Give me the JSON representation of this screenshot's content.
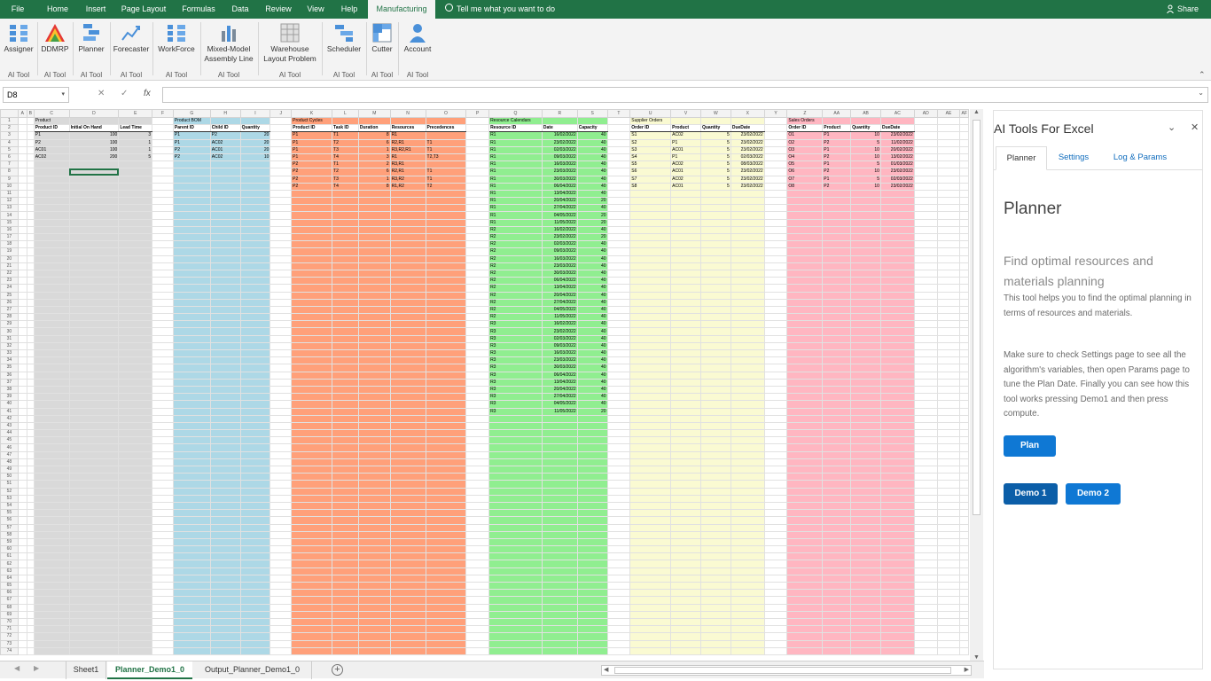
{
  "menu": {
    "items": [
      "File",
      "Home",
      "Insert",
      "Page Layout",
      "Formulas",
      "Data",
      "Review",
      "View",
      "Help",
      "Manufacturing"
    ],
    "active": "Manufacturing",
    "tell_me": "Tell me what you want to do",
    "share": "Share"
  },
  "ribbon": {
    "buttons": [
      {
        "label": "Assigner",
        "group": "AI Tool",
        "icon": "assigner-icon"
      },
      {
        "label": "DDMRP",
        "group": "AI Tool",
        "icon": "ddmrp-icon"
      },
      {
        "label": "Planner",
        "group": "AI Tool",
        "icon": "planner-icon"
      },
      {
        "label": "Forecaster",
        "group": "AI Tool",
        "icon": "forecaster-icon"
      },
      {
        "label": "WorkForce",
        "group": "AI Tool",
        "icon": "workforce-icon"
      },
      {
        "label": "Mixed-Model Assembly Line",
        "group": "AI Tool",
        "icon": "assembly-line-icon"
      },
      {
        "label": "Warehouse Layout Problem",
        "group": "AI Tool",
        "icon": "warehouse-icon"
      },
      {
        "label": "Scheduler",
        "group": "AI Tool",
        "icon": "scheduler-icon"
      },
      {
        "label": "Cutter",
        "group": "AI Tool",
        "icon": "cutter-icon"
      },
      {
        "label": "Account",
        "group": "AI Tool",
        "icon": "account-icon"
      }
    ]
  },
  "formula_bar": {
    "name_box": "D8",
    "fx": "fx",
    "cancel": "✕",
    "enter": "✓",
    "value": ""
  },
  "sheet": {
    "columns": [
      "A",
      "B",
      "C",
      "D",
      "E",
      "F",
      "G",
      "H",
      "I",
      "J",
      "K",
      "L",
      "M",
      "N",
      "O",
      "P",
      "Q",
      "R",
      "S",
      "T",
      "U",
      "V",
      "W",
      "X",
      "Y",
      "Z",
      "AA",
      "AB",
      "AC",
      "AD",
      "AE",
      "AF"
    ],
    "row_count": 74,
    "sections": [
      {
        "title": "Product",
        "headers": [
          "Product ID",
          "Initial On Hand",
          "Lead Time"
        ],
        "color": "#d9d9d9",
        "rows": [
          [
            "P1",
            "100",
            "3"
          ],
          [
            "P2",
            "100",
            "1"
          ],
          [
            "AC01",
            "100",
            "1"
          ],
          [
            "AC02",
            "200",
            "5"
          ]
        ]
      },
      {
        "title": "Product BOM",
        "headers": [
          "Parent ID",
          "Child ID",
          "Quantity"
        ],
        "color": "#add8e6",
        "rows": [
          [
            "P1",
            "P2",
            "20"
          ],
          [
            "P1",
            "AC02",
            "20"
          ],
          [
            "P2",
            "AC01",
            "20"
          ],
          [
            "P2",
            "AC02",
            "10"
          ]
        ]
      },
      {
        "title": "Product Cycles",
        "headers": [
          "Product ID",
          "Task ID",
          "Duration",
          "Resources",
          "Precedences"
        ],
        "color": "#ffa07a",
        "rows": [
          [
            "P1",
            "T1",
            "8",
            "R1",
            ""
          ],
          [
            "P1",
            "T2",
            "6",
            "R2,R1",
            "T1"
          ],
          [
            "P1",
            "T3",
            "1",
            "R3,R2,R1",
            "T1"
          ],
          [
            "P1",
            "T4",
            "3",
            "R1",
            "T2,T3"
          ],
          [
            "P2",
            "T1",
            "2",
            "R3,R1",
            ""
          ],
          [
            "P2",
            "T2",
            "6",
            "R2,R1",
            "T1"
          ],
          [
            "P2",
            "T3",
            "1",
            "R3,R2",
            "T1"
          ],
          [
            "P2",
            "T4",
            "8",
            "R1,R2",
            "T2"
          ]
        ]
      },
      {
        "title": "Resource Calendars",
        "headers": [
          "Resource ID",
          "Date",
          "Capacity"
        ],
        "color": "#90ee90",
        "rows": [
          [
            "R1",
            "16/02/2022",
            "40"
          ],
          [
            "R1",
            "23/02/2022",
            "40"
          ],
          [
            "R1",
            "02/03/2022",
            "40"
          ],
          [
            "R1",
            "09/03/2022",
            "40"
          ],
          [
            "R1",
            "16/03/2022",
            "40"
          ],
          [
            "R1",
            "23/03/2022",
            "40"
          ],
          [
            "R1",
            "30/03/2022",
            "40"
          ],
          [
            "R1",
            "06/04/2022",
            "40"
          ],
          [
            "R1",
            "13/04/2022",
            "40"
          ],
          [
            "R1",
            "20/04/2022",
            "20"
          ],
          [
            "R1",
            "27/04/2022",
            "40"
          ],
          [
            "R1",
            "04/05/2022",
            "20"
          ],
          [
            "R1",
            "11/05/2022",
            "20"
          ],
          [
            "R2",
            "16/02/2022",
            "40"
          ],
          [
            "R2",
            "23/02/2022",
            "20"
          ],
          [
            "R2",
            "02/03/2022",
            "40"
          ],
          [
            "R2",
            "09/03/2022",
            "40"
          ],
          [
            "R2",
            "16/03/2022",
            "40"
          ],
          [
            "R2",
            "23/03/2022",
            "40"
          ],
          [
            "R2",
            "30/03/2022",
            "40"
          ],
          [
            "R2",
            "06/04/2022",
            "40"
          ],
          [
            "R2",
            "13/04/2022",
            "40"
          ],
          [
            "R2",
            "20/04/2022",
            "40"
          ],
          [
            "R2",
            "27/04/2022",
            "40"
          ],
          [
            "R2",
            "04/05/2022",
            "40"
          ],
          [
            "R2",
            "11/05/2022",
            "40"
          ],
          [
            "R3",
            "16/02/2022",
            "40"
          ],
          [
            "R3",
            "23/02/2022",
            "40"
          ],
          [
            "R3",
            "02/03/2022",
            "40"
          ],
          [
            "R3",
            "09/03/2022",
            "40"
          ],
          [
            "R3",
            "16/03/2022",
            "40"
          ],
          [
            "R3",
            "23/03/2022",
            "40"
          ],
          [
            "R3",
            "30/03/2022",
            "40"
          ],
          [
            "R3",
            "06/04/2022",
            "40"
          ],
          [
            "R3",
            "13/04/2022",
            "40"
          ],
          [
            "R3",
            "20/04/2022",
            "40"
          ],
          [
            "R3",
            "27/04/2022",
            "40"
          ],
          [
            "R3",
            "04/05/2022",
            "40"
          ],
          [
            "R3",
            "11/05/2022",
            "20"
          ]
        ]
      },
      {
        "title": "Supplier Orders",
        "headers": [
          "Order ID",
          "Product",
          "Quantity",
          "DueDate"
        ],
        "color": "#fafad2",
        "rows": [
          [
            "S1",
            "AC02",
            "5",
            "23/02/2022"
          ],
          [
            "S2",
            "P1",
            "5",
            "23/02/2022"
          ],
          [
            "S3",
            "AC01",
            "5",
            "23/02/2022"
          ],
          [
            "S4",
            "P1",
            "5",
            "02/03/2022"
          ],
          [
            "S5",
            "AC02",
            "5",
            "08/03/2022"
          ],
          [
            "S6",
            "AC01",
            "5",
            "23/02/2022"
          ],
          [
            "S7",
            "AC02",
            "5",
            "23/02/2022"
          ],
          [
            "S8",
            "AC01",
            "5",
            "23/02/2022"
          ]
        ]
      },
      {
        "title": "Sales Orders",
        "headers": [
          "Order ID",
          "Product",
          "Quantity",
          "DueDate"
        ],
        "color": "#ffb6c1",
        "rows": [
          [
            "O1",
            "P1",
            "10",
            "23/02/2022"
          ],
          [
            "O2",
            "P2",
            "5",
            "11/02/2022"
          ],
          [
            "O3",
            "P1",
            "10",
            "20/02/2022"
          ],
          [
            "O4",
            "P2",
            "10",
            "13/02/2022"
          ],
          [
            "O5",
            "P1",
            "5",
            "01/03/2022"
          ],
          [
            "O6",
            "P2",
            "10",
            "23/02/2022"
          ],
          [
            "O7",
            "P1",
            "5",
            "02/03/2022"
          ],
          [
            "O8",
            "P2",
            "10",
            "23/02/2022"
          ]
        ]
      }
    ]
  },
  "sheet_tabs": {
    "items": [
      "Sheet1",
      "Planner_Demo1_0",
      "Output_Planner_Demo1_0"
    ],
    "active": "Planner_Demo1_0",
    "add": "+"
  },
  "pane": {
    "title": "AI Tools For Excel",
    "tabs": [
      "Planner",
      "Settings",
      "Log & Params"
    ],
    "active_tab": "Planner",
    "heading": "Planner",
    "subheading": "Find optimal resources and materials planning",
    "description": "This tool helps you to find the optimal planning in terms of resources and materials.",
    "instructions": "Make sure to check Settings page to see all the algorithm's variables, then open Params page to tune the Plan Date. Finally you can see how this tool works pressing Demo1 and then press compute.",
    "plan_button": "Plan",
    "demo1_button": "Demo 1",
    "demo2_button": "Demo 2",
    "menu_glyph": "⌄",
    "close_glyph": "✕"
  },
  "colors": {
    "excel_green": "#217346",
    "accent_blue": "#0f78d4"
  }
}
